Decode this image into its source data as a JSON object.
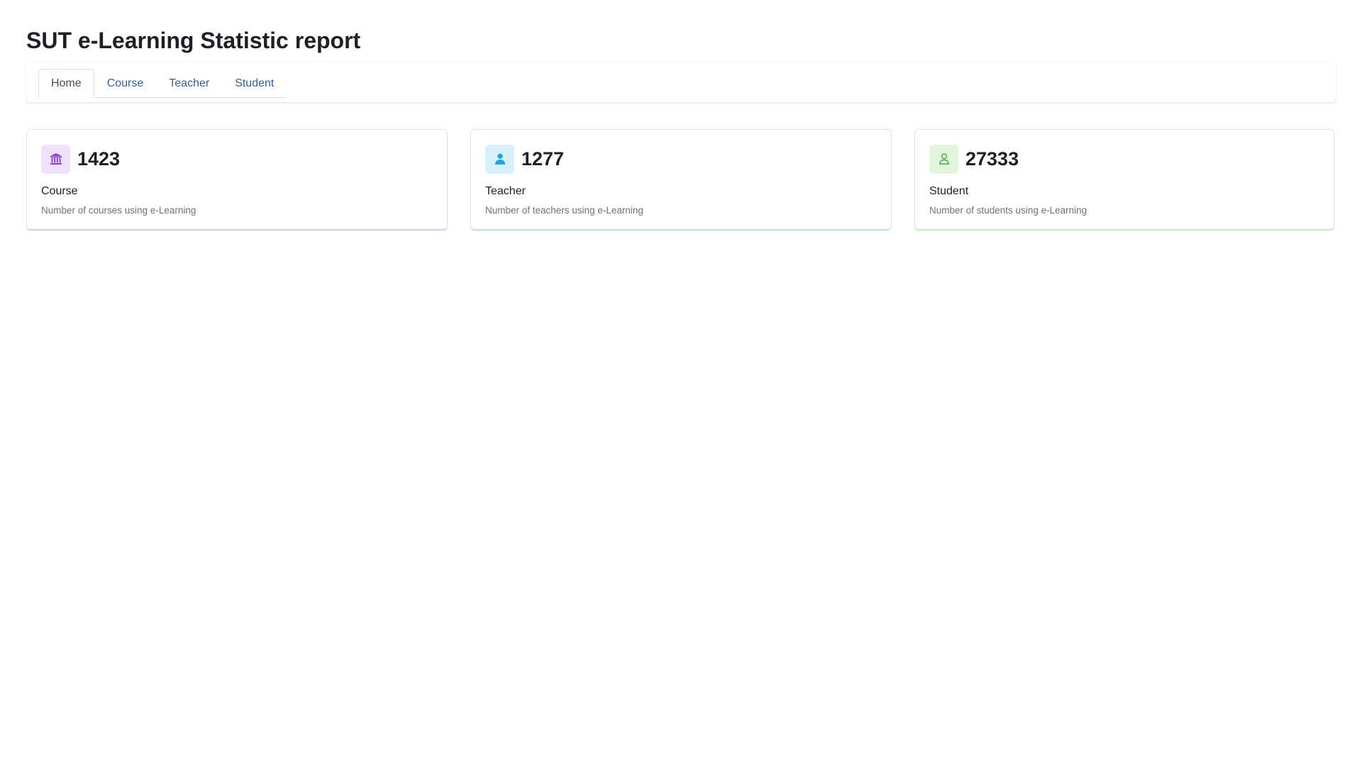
{
  "page": {
    "title": "SUT e-Learning Statistic report"
  },
  "tabs": [
    {
      "label": "Home",
      "active": true
    },
    {
      "label": "Course",
      "active": false
    },
    {
      "label": "Teacher",
      "active": false
    },
    {
      "label": "Student",
      "active": false
    }
  ],
  "cards": [
    {
      "count": "1423",
      "label": "Course",
      "description": "Number of courses using e-Learning",
      "icon": "institution-icon",
      "accent": "#8a3fd1",
      "icon_bg": "#efe3fb",
      "underline": "#e3c7ef"
    },
    {
      "count": "1277",
      "label": "Teacher",
      "description": "Number of teachers using e-Learning",
      "icon": "user-solid-icon",
      "accent": "#1ea7e4",
      "icon_bg": "#d9f1fc",
      "underline": "#b9e3f5"
    },
    {
      "count": "27333",
      "label": "Student",
      "description": "Number of students using e-Learning",
      "icon": "user-outline-icon",
      "accent": "#4caf50",
      "icon_bg": "#e3f5dc",
      "underline": "#c6edb3"
    }
  ]
}
